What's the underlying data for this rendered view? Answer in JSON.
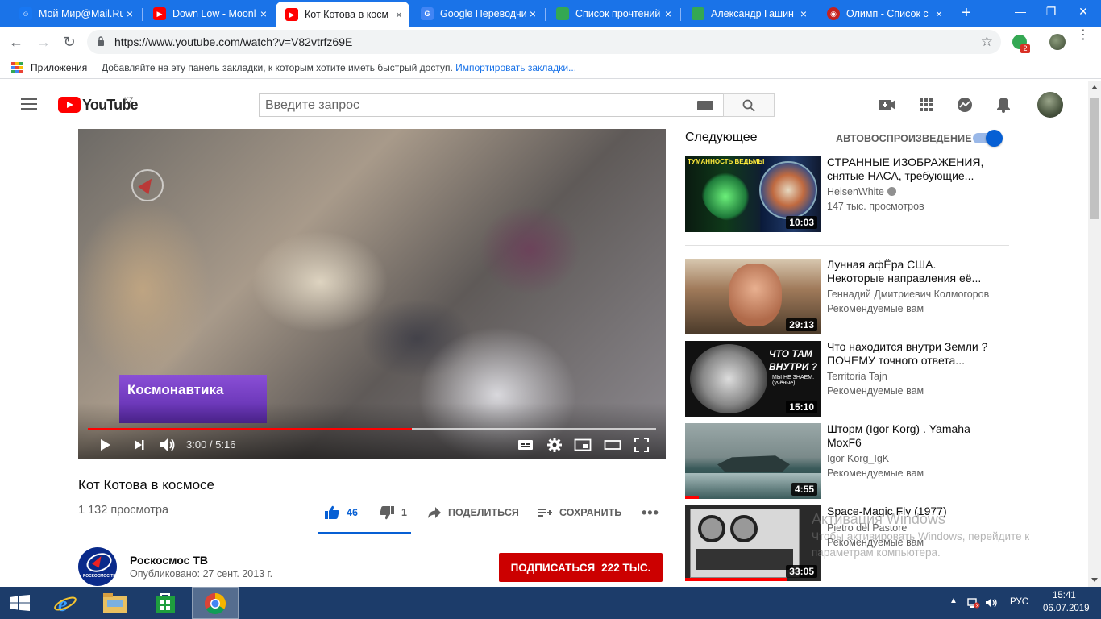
{
  "browser": {
    "tabs": [
      {
        "label": "Мой Мир@Mail.Ru",
        "icon": "mailru-icon",
        "color": "#1877f2"
      },
      {
        "label": "Down Low - Moonl",
        "icon": "youtube-icon",
        "color": "#ff0000"
      },
      {
        "label": "Кот Котова в косм",
        "icon": "youtube-icon",
        "color": "#ff0000",
        "active": true
      },
      {
        "label": "Google Переводчи",
        "icon": "translate-icon",
        "color": "#4285f4"
      },
      {
        "label": "Список прочтений",
        "icon": "sheet-icon",
        "color": "#34a853"
      },
      {
        "label": "Александр Гашин",
        "icon": "sheet-icon",
        "color": "#34a853"
      },
      {
        "label": "Олимп - Список с",
        "icon": "olymp-icon",
        "color": "#c5221f"
      }
    ],
    "url": "https://www.youtube.com/watch?v=V82vtrfz69E",
    "extension_badge": "2",
    "bookmarks": {
      "apps_label": "Приложения",
      "hint": "Добавляйте на эту панель закладки, к которым хотите иметь быстрый доступ.",
      "import_link": "Импортировать закладки..."
    }
  },
  "masthead": {
    "logo_word": "YouTube",
    "region": "KZ",
    "search_placeholder": "Введите запрос"
  },
  "player": {
    "lower_third": "Космонавтика",
    "time": "3:00 / 5:16",
    "progress": 0.57,
    "buffered": 1.0
  },
  "video": {
    "title": "Кот Котова в космосе",
    "views": "1 132 просмотра",
    "likes": "46",
    "dislikes": "1",
    "share_label": "ПОДЕЛИТЬСЯ",
    "save_label": "СОХРАНИТЬ"
  },
  "channel": {
    "name": "Роскосмос ТВ",
    "logo_text": "РОСКОСМОС ТВ",
    "published": "Опубликовано: 27 сент. 2013 г.",
    "subscribe_label": "ПОДПИСАТЬСЯ",
    "subscribers": "222 ТЫС."
  },
  "sidebar": {
    "up_next": "Следующее",
    "autoplay_label": "АВТОВОСПРОИЗВЕДЕНИЕ",
    "autoplay_on": true,
    "videos": [
      {
        "title": "СТРАННЫЕ ИЗОБРАЖЕНИЯ, снятые НАСА, требующие...",
        "channel": "HeisenWhite",
        "verified": true,
        "meta": "147 тыс. просмотров",
        "duration": "10:03",
        "thumb_text": "ТУМАННОСТЬ ВЕДЬМЫ",
        "watched": 0
      },
      {
        "title": "Лунная афЁра США. Некоторые направления её...",
        "channel": "Геннадий Дмитриевич Колмогоров",
        "verified": false,
        "meta": "Рекомендуемые вам",
        "duration": "29:13",
        "thumb_text": "",
        "watched": 0
      },
      {
        "title": "Что находится внутри Земли ? ПОЧЕМУ точного ответа...",
        "channel": "Territoria Tajn",
        "verified": false,
        "meta": "Рекомендуемые вам",
        "duration": "15:10",
        "thumb_text": "ЧТО ТАМ ВНУТРИ ?",
        "thumb_sub": "МЫ НЕ ЗНАЕМ. (учёные)",
        "watched": 0
      },
      {
        "title": "Шторм (Igor Korg) . Yamaha MoxF6",
        "channel": "Igor Korg_IgK",
        "verified": false,
        "meta": "Рекомендуемые вам",
        "duration": "4:55",
        "thumb_text": "",
        "watched": 0.1
      },
      {
        "title": "Space-Magic Fly (1977)",
        "channel": "Pietro del Pastore",
        "verified": false,
        "meta": "Рекомендуемые вам",
        "duration": "33:05",
        "thumb_text": "",
        "watched": 0.75
      }
    ]
  },
  "watermark": {
    "title": "Активация Windows",
    "line1": "Чтобы активировать Windows, перейдите к",
    "line2": "параметрам компьютера."
  },
  "taskbar": {
    "language": "РУС",
    "time": "15:41",
    "date": "06.07.2019"
  },
  "colors": {
    "chrome_blue": "#1a73e8",
    "youtube_red": "#ff0000",
    "subscribe_red": "#cc0000",
    "link_blue": "#065fd4",
    "taskbar": "#1c3c6a"
  }
}
